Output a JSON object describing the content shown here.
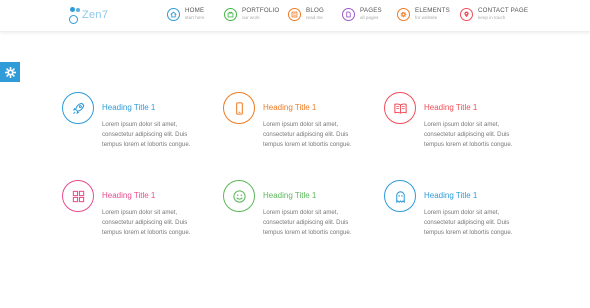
{
  "logo": {
    "text": "Zen7"
  },
  "nav": {
    "items": [
      {
        "label": "HOME",
        "sub": "start here",
        "icon": "home-icon",
        "color": "#2f9bd8"
      },
      {
        "label": "PORTFOLIO",
        "sub": "our work",
        "icon": "briefcase-icon",
        "color": "#44b848"
      },
      {
        "label": "BLOG",
        "sub": "read me",
        "icon": "book-icon",
        "color": "#f07b22"
      },
      {
        "label": "PAGES",
        "sub": "all pages",
        "icon": "pages-icon",
        "color": "#9b59c6"
      },
      {
        "label": "ELEMENTS",
        "sub": "for website",
        "icon": "gear-icon",
        "color": "#f07b22"
      },
      {
        "label": "CONTACT PAGE",
        "sub": "keep in touch",
        "icon": "map-pin-icon",
        "color": "#ef4e5a"
      }
    ]
  },
  "settings_tab": {
    "icon": "gear-icon",
    "color": "#2f9bd8"
  },
  "features": [
    {
      "title": "Heading Title 1",
      "icon": "rocket-icon",
      "color": "#2f9bd8",
      "lines": [
        "Lorem ipsum dolor sit amet,",
        "consectetur adipiscing elit. Duis",
        "tempus lorem et lobortis congue."
      ]
    },
    {
      "title": "Heading Title 1",
      "icon": "mobile-icon",
      "color": "#f07b22",
      "lines": [
        "Lorem ipsum dolor sit amet,",
        "consectetur adipiscing elit. Duis",
        "tempus lorem et lobortis congue."
      ]
    },
    {
      "title": "Heading Title 1",
      "icon": "open-book-icon",
      "color": "#ef4e5a",
      "lines": [
        "Lorem ipsum dolor sit amet,",
        "consectetur adipiscing elit. Duis",
        "tempus lorem et lobortis congue."
      ]
    },
    {
      "title": "Heading Title 1",
      "icon": "grid-icon",
      "color": "#e94c8c",
      "lines": [
        "Lorem ipsum dolor sit amet,",
        "consectetur adipiscing elit. Duis",
        "tempus lorem et lobortis congue."
      ]
    },
    {
      "title": "Heading Title 1",
      "icon": "smiley-icon",
      "color": "#5cb85c",
      "lines": [
        "Lorem ipsum dolor sit amet,",
        "consectetur adipiscing elit. Duis",
        "tempus lorem et lobortis congue."
      ]
    },
    {
      "title": "Heading Title 1",
      "icon": "ghost-icon",
      "color": "#2f9bd8",
      "lines": [
        "Lorem ipsum dolor sit amet,",
        "consectetur adipiscing elit. Duis",
        "tempus lorem et lobortis congue."
      ]
    }
  ]
}
